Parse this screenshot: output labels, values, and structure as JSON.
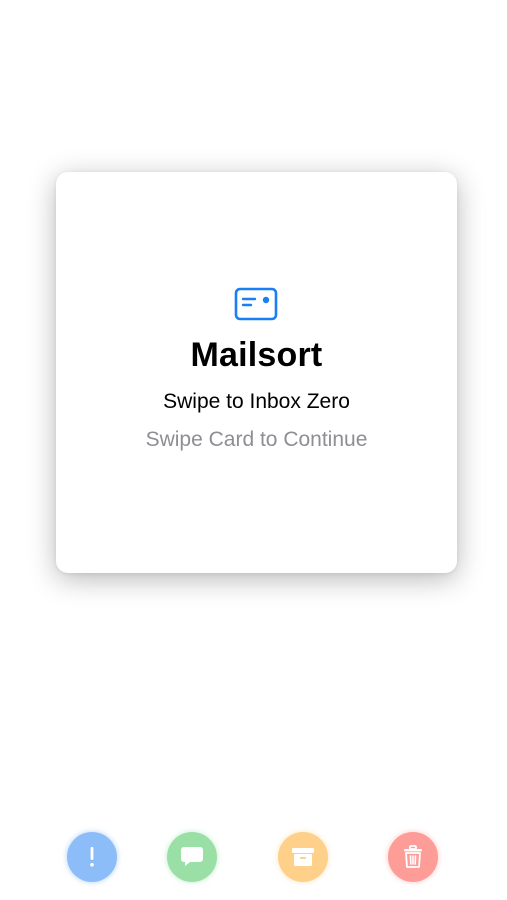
{
  "card": {
    "icon": "id-card-icon",
    "title": "Mailsort",
    "subtitle": "Swipe to Inbox Zero",
    "hint": "Swipe Card to Continue"
  },
  "actions": [
    {
      "name": "flag",
      "icon": "exclamation-icon",
      "color": "#8dbdf8"
    },
    {
      "name": "reply",
      "icon": "message-bubble-icon",
      "color": "#9ae0a6"
    },
    {
      "name": "archive",
      "icon": "archive-box-icon",
      "color": "#fed08a"
    },
    {
      "name": "trash",
      "icon": "trash-icon",
      "color": "#fe9c98"
    }
  ],
  "colors": {
    "accent": "#1a7ef5",
    "hint": "#8e8e93"
  }
}
